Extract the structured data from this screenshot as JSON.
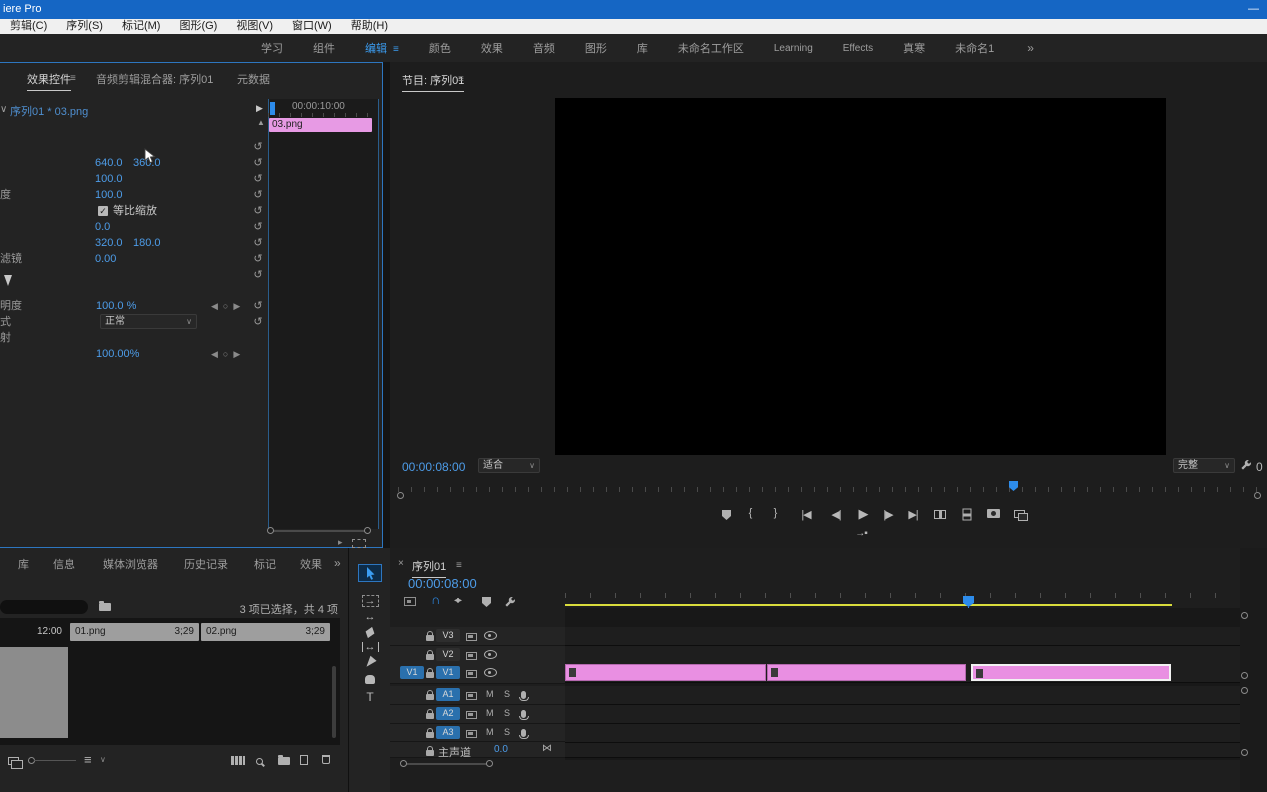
{
  "window": {
    "title_fragment": "iere Pro"
  },
  "glyphs": {
    "panel_menu": "≡",
    "close": "×",
    "chevron_down": "∨",
    "chevron_double": "»",
    "reset": "↺",
    "magnet": "∩",
    "collapse_up": "▲",
    "expand_right": "▶",
    "play": "▶",
    "step_back": "◀|",
    "step_fwd": "|▶",
    "goto_in": "|◀",
    "goto_out": "▶|",
    "brace_in": "{",
    "brace_out": "}",
    "tri_left": "◀",
    "tri_right": "▶",
    "keyframe_dot": "○",
    "check": "✓",
    "type_tool": "T",
    "arrow_right": "→",
    "arrows_lr": "↔",
    "sort": "≡",
    "minimize": "—",
    "mute": "M",
    "solo": "S",
    "bowtie": "⋈",
    "small_play": "▸",
    "link_sel": "◂▸",
    "export_arrow": "→▪"
  },
  "menu_bar": [
    "剪辑(C)",
    "序列(S)",
    "标记(M)",
    "图形(G)",
    "视图(V)",
    "窗口(W)",
    "帮助(H)"
  ],
  "workspace": {
    "tabs": [
      "学习",
      "组件",
      "编辑",
      "颜色",
      "效果",
      "音频",
      "图形",
      "库",
      "未命名工作区",
      "Learning",
      "Effects",
      "真寒",
      "未命名1"
    ]
  },
  "effect_controls": {
    "tabs": [
      "效果控件",
      "音频剪辑混合器: 序列01",
      "元数据"
    ],
    "clip_title": "序列01 * 03.png",
    "ruler_label": "00:00:10:00",
    "clip_name": "03.png",
    "params": {
      "position": {
        "x": "640.0",
        "y": "360.0"
      },
      "scale": {
        "value": "100.0"
      },
      "scale_width": {
        "label_fragment": "度",
        "value": "100.0"
      },
      "uniform_scale": {
        "label": "等比缩放"
      },
      "rotation": {
        "value": "0.0"
      },
      "anchor": {
        "x": "320.0",
        "y": "180.0"
      },
      "anti_flicker": {
        "label_fragment": "滤镜",
        "value": "0.00"
      },
      "opacity": {
        "label_fragment": "明度",
        "value": "100.0 %"
      },
      "blend_mode": {
        "label_fragment": "式",
        "value": "正常"
      },
      "time_remap": {
        "label_fragment": "射"
      },
      "speed": {
        "value": "100.00%"
      }
    }
  },
  "program_monitor": {
    "tab": "节目: 序列01",
    "timecode": "00:00:08:00",
    "fit_select": "适合",
    "quality_select": "完整",
    "edge_fragment": "0"
  },
  "project_panel": {
    "tabs": [
      "库",
      "信息",
      "媒体浏览器",
      "历史记录",
      "标记",
      "效果"
    ],
    "status": "3 项已选择，共 4 项",
    "cells": {
      "c0": "12:00",
      "c1_name": "01.png",
      "c1_duration": "3;29",
      "c2_name": "02.png",
      "c2_duration": "3;29"
    }
  },
  "timeline": {
    "tab": "序列01",
    "timecode": "00:00:08:00",
    "tracks": {
      "v3": "V3",
      "v2": "V2",
      "v1": "V1",
      "patch_v1": "V1",
      "a1": "A1",
      "a2": "A2",
      "a3": "A3",
      "master_label": "主声道",
      "master_value": "0.0"
    }
  },
  "colors": {
    "accent": "#2d8ceb",
    "clip_pink": "#e98fe2",
    "render_bar_yellow": "#d9dc3c",
    "titlebar_blue": "#1566c4",
    "value_blue": "#4d9ce8"
  }
}
